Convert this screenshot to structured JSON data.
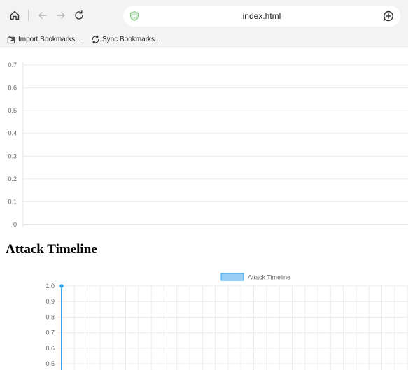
{
  "browser": {
    "url": "index.html",
    "bookmarks": [
      {
        "label": "Import Bookmarks...",
        "icon": "import-icon"
      },
      {
        "label": "Sync Bookmarks...",
        "icon": "sync-icon"
      }
    ]
  },
  "page": {
    "heading": "Attack Timeline"
  },
  "chart_data": [
    {
      "type": "line",
      "y_ticks": [
        "0.7",
        "0.6",
        "0.5",
        "0.4",
        "0.3",
        "0.2",
        "0.1",
        "0"
      ],
      "ylim": [
        0,
        0.7
      ],
      "grid": true,
      "series": []
    },
    {
      "type": "line",
      "legend": {
        "position": "top",
        "label": "Attack Timeline"
      },
      "y_ticks": [
        "1.0",
        "0.9",
        "0.8",
        "0.7",
        "0.6",
        "0.5"
      ],
      "ylim": [
        0.5,
        1.0
      ],
      "grid": true,
      "color": "#36a2eb",
      "series": [
        {
          "name": "Attack Timeline",
          "values": [
            1.0
          ]
        }
      ]
    }
  ]
}
